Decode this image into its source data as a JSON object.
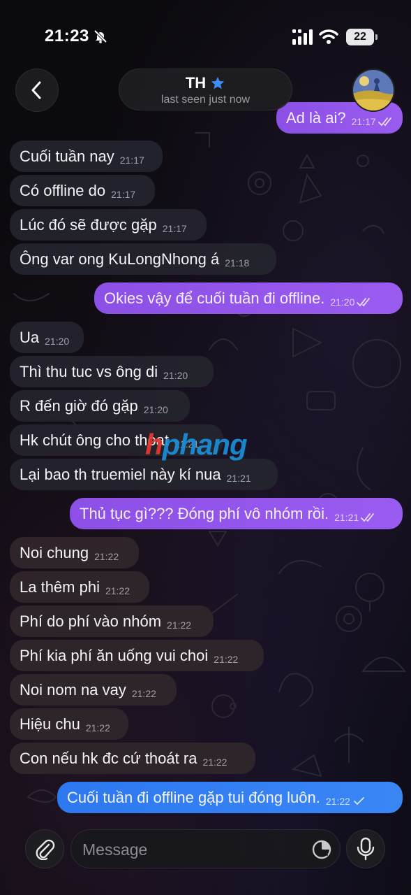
{
  "status_bar": {
    "time": "21:23",
    "battery": "22"
  },
  "header": {
    "back_icon": "chevron-left-icon",
    "contact_name": "TH",
    "badge_icon": "star-icon",
    "badge_color": "#3d8bf5",
    "last_seen": "last seen just now"
  },
  "watermark": {
    "part1": "h",
    "part2": "phang"
  },
  "messages": [
    {
      "direction": "out",
      "text": "Ad là ai?",
      "time": "21:17",
      "status": "read"
    },
    {
      "direction": "in",
      "text": "Cuối tuần nay",
      "time": "21:17"
    },
    {
      "direction": "in",
      "text": "Có offline do",
      "time": "21:17"
    },
    {
      "direction": "in",
      "text": "Lúc đó sẽ được gặp",
      "time": "21:17"
    },
    {
      "direction": "in",
      "text": "Ông var ong KuLongNhong á",
      "time": "21:18"
    },
    {
      "direction": "out",
      "text": "Okies vậy để cuối tuần đi offline.",
      "time": "21:20",
      "status": "read"
    },
    {
      "direction": "in",
      "text": "Ua",
      "time": "21:20"
    },
    {
      "direction": "in",
      "text": "Thì thu tuc vs ông di",
      "time": "21:20"
    },
    {
      "direction": "in",
      "text": "R đến giờ đó gặp",
      "time": "21:20"
    },
    {
      "direction": "in",
      "text": "Hk chút ông cho thoat",
      "time": "21:21"
    },
    {
      "direction": "in",
      "text": "Lại bao th truemiel này kí nua",
      "time": "21:21"
    },
    {
      "direction": "out",
      "text": "Thủ tục gì??? Đóng phí vô nhóm rồi.",
      "time": "21:21",
      "status": "read"
    },
    {
      "direction": "in",
      "text": "Noi chung",
      "time": "21:22"
    },
    {
      "direction": "in",
      "text": "La thêm phi",
      "time": "21:22"
    },
    {
      "direction": "in",
      "text": "Phí do phí vào nhóm",
      "time": "21:22"
    },
    {
      "direction": "in",
      "text": "Phí kia phí ăn uống vui choi",
      "time": "21:22"
    },
    {
      "direction": "in",
      "text": "Noi nom na vay",
      "time": "21:22"
    },
    {
      "direction": "in",
      "text": "Hiệu chu",
      "time": "21:22"
    },
    {
      "direction": "in",
      "text": "Con nếu hk đc cứ thoát ra",
      "time": "21:22"
    },
    {
      "direction": "out",
      "text": "Cuối tuần đi offline gặp tui đóng luôn.",
      "time": "21:22",
      "status": "sent"
    }
  ],
  "composer": {
    "attach_icon": "paperclip-icon",
    "placeholder": "Message",
    "sticker_icon": "sticker-icon",
    "mic_icon": "microphone-icon"
  },
  "colors": {
    "outgoing_purple": "#9157ea",
    "outgoing_blue": "#3380f2",
    "incoming": "#24242e"
  }
}
